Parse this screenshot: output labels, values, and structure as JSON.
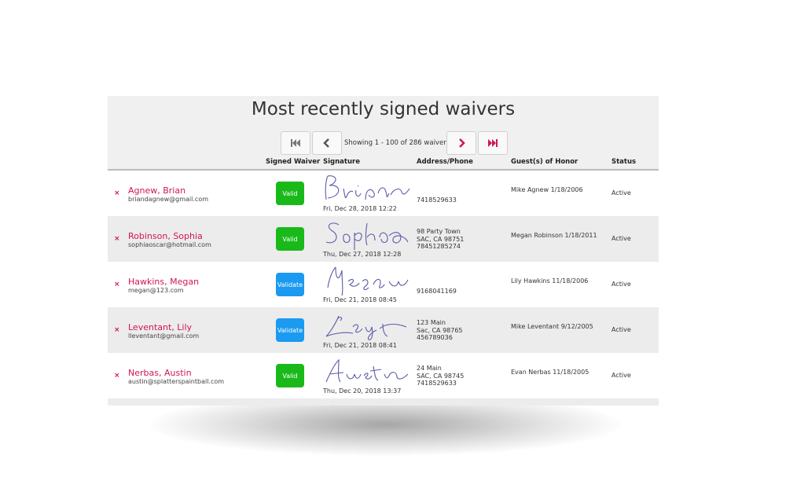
{
  "title": "Most recently signed waivers",
  "pager": {
    "showing": "Showing 1 - 100 of 286 waivers"
  },
  "columns": {
    "signed_waiver": "Signed Waiver",
    "signature": "Signature",
    "address": "Address/Phone",
    "guests": "Guest(s) of Honor",
    "status": "Status"
  },
  "rows": [
    {
      "name": "Agnew, Brian",
      "email": "briandagnew@gmail.com",
      "badge": "Valid",
      "signed": "Fri, Dec 28, 2018 12:22",
      "addr1": "",
      "addr2": "",
      "phone": "7418529633",
      "guest": "Mike Agnew 1/18/2006",
      "status": "Active"
    },
    {
      "name": "Robinson, Sophia",
      "email": "sophiaoscar@hotmail.com",
      "badge": "Valid",
      "signed": "Thu, Dec 27, 2018 12:28",
      "addr1": "98 Party Town",
      "addr2": "SAC, CA 98751",
      "phone": "78451285274",
      "guest": "Megan Robinson 1/18/2011",
      "status": "Active"
    },
    {
      "name": "Hawkins, Megan",
      "email": "megan@123.com",
      "badge": "Validate",
      "signed": "Fri, Dec 21, 2018 08:45",
      "addr1": "",
      "addr2": "",
      "phone": "9168041169",
      "guest": "Lily Hawkins 11/18/2006",
      "status": "Active"
    },
    {
      "name": "Leventant, Lily",
      "email": "lleventant@gmail.com",
      "badge": "Validate",
      "signed": "Fri, Dec 21, 2018 08:41",
      "addr1": "123 Main",
      "addr2": "Sac, CA 98765",
      "phone": "456789036",
      "guest": "Mike Leventant 9/12/2005",
      "status": "Active"
    },
    {
      "name": "Nerbas, Austin",
      "email": "austin@splatterspaintball.com",
      "badge": "Valid",
      "signed": "Thu, Dec 20, 2018 13:37",
      "addr1": "24 Main",
      "addr2": "SAC, CA 98745",
      "phone": "7418529633",
      "guest": "Evan Nerbas 11/18/2005",
      "status": "Active"
    }
  ],
  "remove_mark": "×",
  "icons": {
    "first": "first-page-icon",
    "prev": "chevron-left-icon",
    "next": "chevron-right-icon",
    "last": "last-page-icon",
    "remove": "close-icon"
  },
  "colors": {
    "accent": "#d0174f",
    "valid": "#1ab91a",
    "validate": "#1a9af0",
    "header_bg": "#f0f0f0",
    "alt_row": "#ececec"
  }
}
